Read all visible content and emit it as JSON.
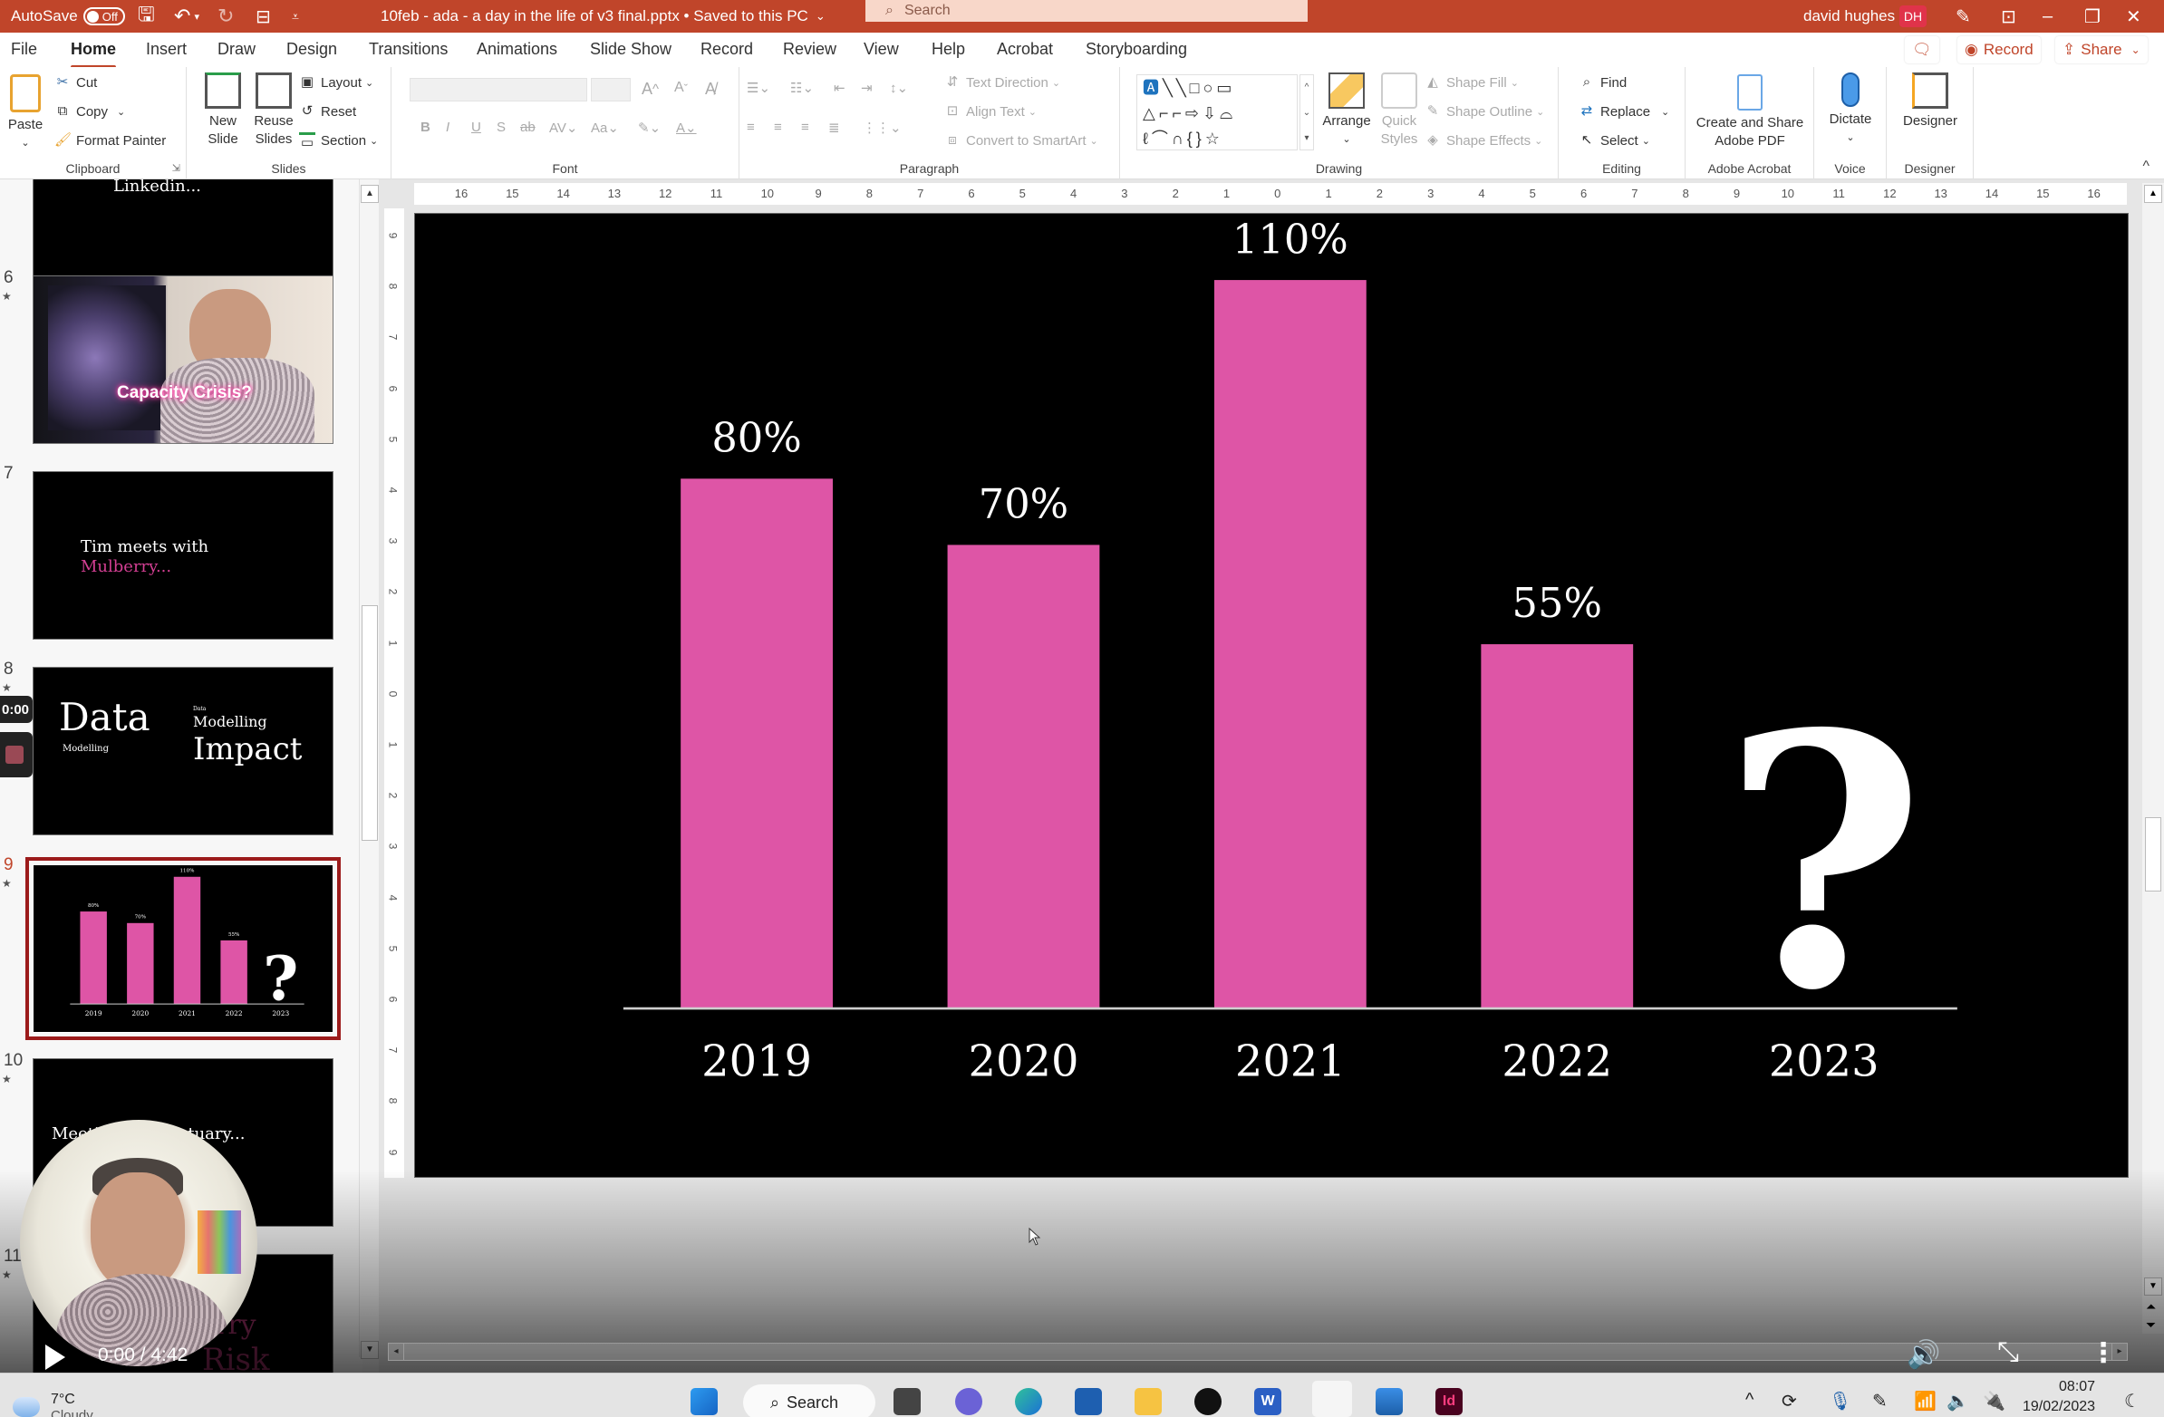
{
  "titlebar": {
    "autosave_label": "AutoSave",
    "autosave_state": "Off",
    "doc_title": "10feb - ada - a day in the life of v3 final.pptx • Saved to this PC",
    "search_placeholder": "Search",
    "user_name": "david hughes",
    "user_initials": "DH"
  },
  "tabs": [
    "File",
    "Home",
    "Insert",
    "Draw",
    "Design",
    "Transitions",
    "Animations",
    "Slide Show",
    "Record",
    "Review",
    "View",
    "Help",
    "Acrobat",
    "Storyboarding"
  ],
  "active_tab": "Home",
  "top_actions": {
    "record": "Record",
    "share": "Share"
  },
  "ribbon": {
    "clipboard": {
      "label": "Clipboard",
      "paste": "Paste",
      "cut": "Cut",
      "copy": "Copy",
      "format_painter": "Format Painter"
    },
    "slides": {
      "label": "Slides",
      "new_slide": "New Slide",
      "reuse_slides": "Reuse Slides",
      "layout": "Layout",
      "reset": "Reset",
      "section": "Section"
    },
    "font": {
      "label": "Font",
      "font_name": "",
      "font_size": ""
    },
    "paragraph": {
      "label": "Paragraph",
      "text_direction": "Text Direction",
      "align_text": "Align Text",
      "convert_smartart": "Convert to SmartArt"
    },
    "drawing": {
      "label": "Drawing",
      "arrange": "Arrange",
      "quick_styles": "Quick Styles",
      "shape_fill": "Shape Fill",
      "shape_outline": "Shape Outline",
      "shape_effects": "Shape Effects"
    },
    "editing": {
      "label": "Editing",
      "find": "Find",
      "replace": "Replace",
      "select": "Select"
    },
    "acrobat": {
      "label": "Adobe Acrobat",
      "create_share": "Create and Share Adobe PDF"
    },
    "voice": {
      "label": "Voice",
      "dictate": "Dictate"
    },
    "designer": {
      "label": "Designer",
      "designer": "Designer"
    }
  },
  "rulers": {
    "horizontal": [
      "16",
      "15",
      "14",
      "13",
      "12",
      "11",
      "10",
      "9",
      "8",
      "7",
      "6",
      "5",
      "4",
      "3",
      "2",
      "1",
      "0",
      "1",
      "2",
      "3",
      "4",
      "5",
      "6",
      "7",
      "8",
      "9",
      "10",
      "11",
      "12",
      "13",
      "14",
      "15",
      "16"
    ],
    "vertical": [
      "9",
      "8",
      "7",
      "6",
      "5",
      "4",
      "3",
      "2",
      "1",
      "0",
      "1",
      "2",
      "3",
      "4",
      "5",
      "6",
      "7",
      "8",
      "9"
    ]
  },
  "thumbnails": [
    {
      "number": "",
      "title": "Linkedin..."
    },
    {
      "number": "6",
      "caption": "Capacity Crisis?"
    },
    {
      "number": "7",
      "line1": "Tim meets with",
      "line2": "Mulberry..."
    },
    {
      "number": "8",
      "big_left": "Data",
      "small_left": "Modelling",
      "tiny_right": "Data",
      "mid_right": "Modelling",
      "big_right": "Impact"
    },
    {
      "number": "9",
      "selected": true
    },
    {
      "number": "10",
      "text": "Meeting with Actuary..."
    },
    {
      "number": "11",
      "text_a": "rry",
      "text_b": "Risk"
    }
  ],
  "chart_data": {
    "type": "bar",
    "title": "",
    "categories": [
      "2019",
      "2020",
      "2021",
      "2022",
      "2023"
    ],
    "values": [
      80,
      70,
      110,
      55,
      null
    ],
    "data_labels": [
      "80%",
      "70%",
      "110%",
      "55%",
      ""
    ],
    "placeholder_2023": "?",
    "xlabel": "",
    "ylabel": "",
    "ylim": [
      0,
      120
    ],
    "grid": false,
    "bar_color": "#de55a6",
    "background": "#000000",
    "text_color": "#ffffff"
  },
  "video": {
    "time": "0:00 / 4:42",
    "recording_timer": "0:00"
  },
  "taskbar": {
    "weather_temp": "7°C",
    "weather_desc": "Cloudy",
    "search": "Search",
    "time": "08:07",
    "date": "19/02/2023"
  }
}
